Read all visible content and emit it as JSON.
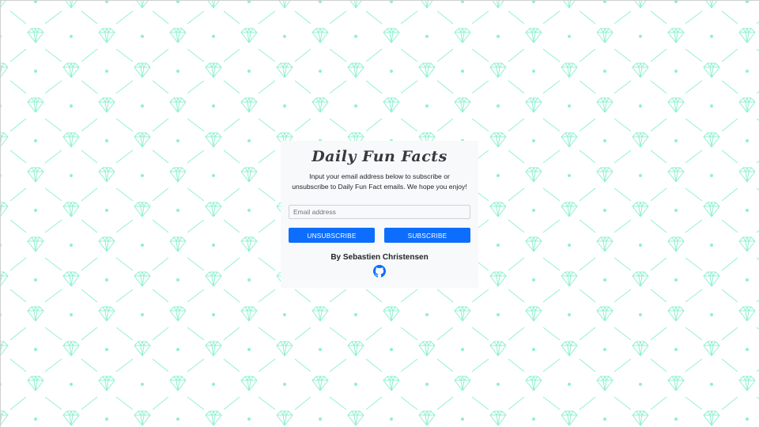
{
  "card": {
    "title": "Daily Fun Facts",
    "description": "Input your email address below to subscribe or unsubscribe to Daily Fun Fact emails. We hope you enjoy!",
    "email_placeholder": "Email address",
    "unsubscribe_label": "UNSUBSCRIBE",
    "subscribe_label": "SUBSCRIBE",
    "author": "By Sebastien Christensen",
    "github_icon": "github-icon"
  },
  "colors": {
    "pattern": "#8ff0d2",
    "button": "#0d6efd",
    "card": "#f8f9fa"
  }
}
